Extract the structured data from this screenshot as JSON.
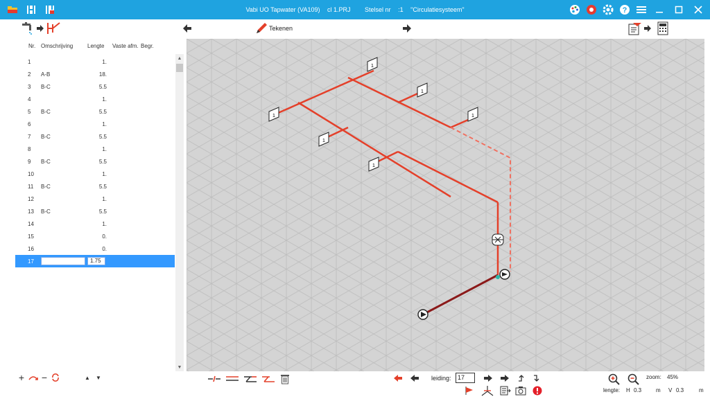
{
  "window": {
    "app_title": "Vabi UO Tapwater (VA109)",
    "file": "cl 1.PRJ",
    "stelsel_label": "Stelsel nr",
    "stelsel_nr": ":1",
    "stelsel_name": "\"Circulatiesysteem\""
  },
  "toolbar": {
    "draw_label": "Tekenen"
  },
  "table": {
    "headers": {
      "nr": "Nr.",
      "omschrijving": "Omschrijving",
      "lengte": "Lengte",
      "vaste": "Vaste afm.",
      "begr": "Begr."
    },
    "rows": [
      {
        "nr": "1",
        "omschrijving": "",
        "lengte": "1."
      },
      {
        "nr": "2",
        "omschrijving": "A-B",
        "lengte": "18."
      },
      {
        "nr": "3",
        "omschrijving": "B-C",
        "lengte": "5.5"
      },
      {
        "nr": "4",
        "omschrijving": "",
        "lengte": "1."
      },
      {
        "nr": "5",
        "omschrijving": "B-C",
        "lengte": "5.5"
      },
      {
        "nr": "6",
        "omschrijving": "",
        "lengte": "1."
      },
      {
        "nr": "7",
        "omschrijving": "B-C",
        "lengte": "5.5"
      },
      {
        "nr": "8",
        "omschrijving": "",
        "lengte": "1."
      },
      {
        "nr": "9",
        "omschrijving": "B-C",
        "lengte": "5.5"
      },
      {
        "nr": "10",
        "omschrijving": "",
        "lengte": "1."
      },
      {
        "nr": "11",
        "omschrijving": "B-C",
        "lengte": "5.5"
      },
      {
        "nr": "12",
        "omschrijving": "",
        "lengte": "1."
      },
      {
        "nr": "13",
        "omschrijving": "B-C",
        "lengte": "5.5"
      },
      {
        "nr": "14",
        "omschrijving": "",
        "lengte": "1."
      },
      {
        "nr": "15",
        "omschrijving": "",
        "lengte": "0."
      },
      {
        "nr": "16",
        "omschrijving": "",
        "lengte": "0."
      }
    ],
    "selected_row": {
      "nr": "17",
      "omschrijving": "",
      "lengte": "1.75"
    }
  },
  "canvas": {
    "tap_label": "1",
    "colors": {
      "grid_bg": "#d4d4d4",
      "grid_line": "#bdbdbd",
      "pipe": "#e4402a",
      "pipe_return": "#f07060",
      "supply": "#8b1a1a"
    }
  },
  "bottom": {
    "leiding_label": "leiding:",
    "leiding_value": "17",
    "zoom_label": "zoom:",
    "zoom_value": "45%",
    "lengte_label": "lengte:",
    "h_label": "H",
    "h_value": "0.3",
    "h_unit": "m",
    "v_label": "V",
    "v_value": "0.3",
    "v_unit": "m"
  },
  "colors": {
    "titlebar": "#1fa3e0",
    "selection": "#3399ff",
    "accent_red": "#d9322b"
  }
}
